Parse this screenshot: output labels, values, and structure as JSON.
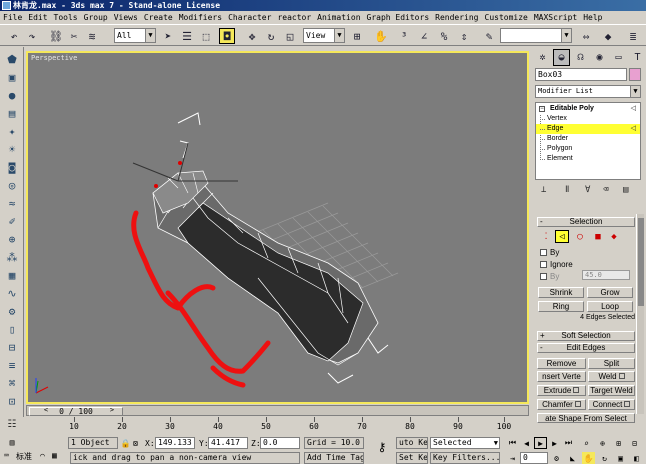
{
  "window": {
    "title": "林肯龙.max - 3ds max 7 - Stand-alone License"
  },
  "menu": [
    "File",
    "Edit",
    "Tools",
    "Group",
    "Views",
    "Create",
    "Modifiers",
    "Character",
    "reactor",
    "Animation",
    "Graph Editors",
    "Rendering",
    "Customize",
    "MAXScript",
    "Help"
  ],
  "toolbar": {
    "selection_filter": "All",
    "reference_coord": "View"
  },
  "viewport": {
    "label": "Perspective"
  },
  "command_panel": {
    "object_name": "Box03",
    "object_color": "#e8a0d0",
    "modifier_list": "Modifier List",
    "stack": {
      "root": "Editable Poly",
      "items": [
        "Vertex",
        "Edge",
        "Border",
        "Polygon",
        "Element"
      ],
      "selected": "Edge"
    },
    "selection_rollout": {
      "title": "Selection",
      "by_vertex": "By",
      "ignore_backfacing": "Ignore",
      "by_angle": "By",
      "angle_value": "45.0",
      "shrink": "Shrink",
      "grow": "Grow",
      "ring": "Ring",
      "loop": "Loop",
      "info": "4 Edges Selected"
    },
    "soft_selection_title": "Soft Selection",
    "edit_edges": {
      "title": "Edit Edges",
      "remove": "Remove",
      "split": "Split",
      "insert_vertex": "nsert Verte",
      "weld": "Weld",
      "extrude": "Extrude",
      "target_weld": "Target Weld",
      "chamfer": "Chamfer",
      "connect": "Connect",
      "create_shape": "ate Shape From Select"
    }
  },
  "time_slider": {
    "label": "0 / 100"
  },
  "track_bar": {
    "ticks": [
      "10",
      "20",
      "30",
      "40",
      "50",
      "60",
      "70",
      "80",
      "90",
      "100"
    ]
  },
  "status": {
    "objects": "1 Object",
    "x_label": "X:",
    "x_value": "149.133",
    "y_label": "Y:",
    "y_value": "41.417",
    "z_label": "Z:",
    "z_value": "0.0",
    "grid": "Grid = 10.0",
    "prompt": "ick and drag to pan a non-camera view",
    "add_time_tag": "Add Time Tag",
    "auto_key": "uto Key",
    "selected": "Selected",
    "set_key": "Set Key",
    "key_filters": "Key Filters...",
    "frame": "0",
    "tray_label": "标准"
  }
}
